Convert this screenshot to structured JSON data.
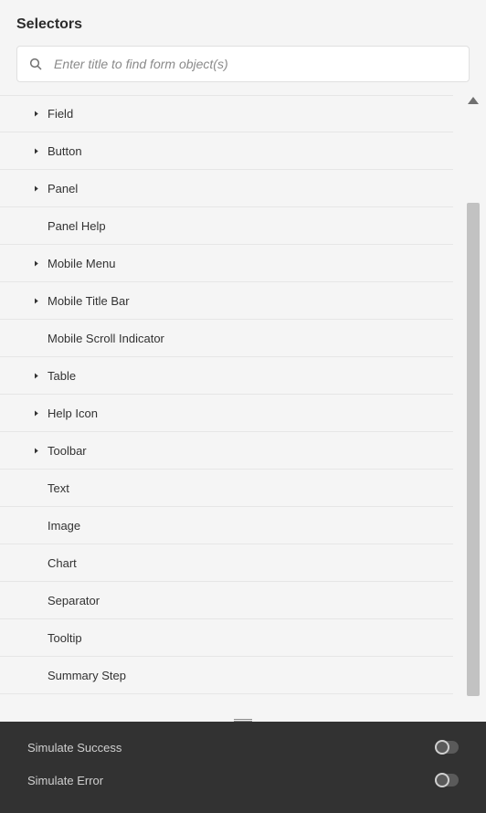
{
  "header": {
    "title": "Selectors"
  },
  "search": {
    "placeholder": "Enter title to find form object(s)"
  },
  "selectors": [
    {
      "label": "Field",
      "expandable": true
    },
    {
      "label": "Button",
      "expandable": true
    },
    {
      "label": "Panel",
      "expandable": true
    },
    {
      "label": "Panel Help",
      "expandable": false
    },
    {
      "label": "Mobile Menu",
      "expandable": true
    },
    {
      "label": "Mobile Title Bar",
      "expandable": true
    },
    {
      "label": "Mobile Scroll Indicator",
      "expandable": false
    },
    {
      "label": "Table",
      "expandable": true
    },
    {
      "label": "Help Icon",
      "expandable": true
    },
    {
      "label": "Toolbar",
      "expandable": true
    },
    {
      "label": "Text",
      "expandable": false
    },
    {
      "label": "Image",
      "expandable": false
    },
    {
      "label": "Chart",
      "expandable": false
    },
    {
      "label": "Separator",
      "expandable": false
    },
    {
      "label": "Tooltip",
      "expandable": false
    },
    {
      "label": "Summary Step",
      "expandable": false
    }
  ],
  "footer": {
    "simulate_success": "Simulate Success",
    "simulate_error": "Simulate Error"
  }
}
